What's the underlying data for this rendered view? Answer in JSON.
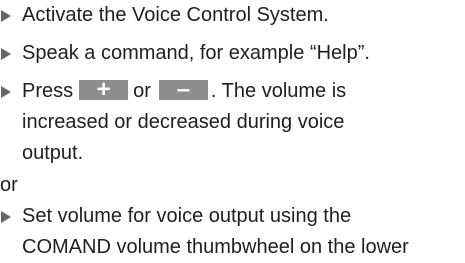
{
  "steps": [
    {
      "lines": [
        "Activate the Voice Control System."
      ]
    },
    {
      "lines": [
        "Speak a command, for example “Help”."
      ]
    },
    {
      "press_word": "Press",
      "or_word": "or",
      "after_keys": ". The volume is",
      "continuation_lines": [
        "increased or decreased during voice",
        "output."
      ]
    },
    {
      "lines": [
        "Set volume for voice output using the",
        "COMAND volume thumbwheel on the lower"
      ]
    }
  ],
  "keys": {
    "plus": {
      "glyph": "+",
      "icon": "plus-key-icon",
      "color": "#8e8e8e"
    },
    "minus": {
      "glyph": "–",
      "icon": "minus-key-icon",
      "color": "#8e8e8e"
    }
  },
  "or_separator": "or"
}
